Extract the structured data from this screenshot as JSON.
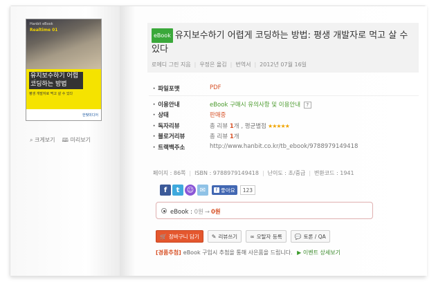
{
  "cover": {
    "series_small": "Hanbit eBook",
    "series_name": "Realtime 01",
    "title_line1": "유지보수하기 어렵게",
    "title_line2": "코딩하는 방법",
    "subtitle": "평생 개발자로 먹고 살 수 있다",
    "publisher": "한빛미디어"
  },
  "zoom": {
    "enlarge": "크게보기",
    "preview": "미리보기"
  },
  "product": {
    "badge": "eBook",
    "title": "유지보수하기 어렵게 코딩하는 방법: 평생 개발자로 먹고 살 수 있다",
    "author": "로에디 그린 지음",
    "translator_credit": "우정은 옮김",
    "type": "번역서",
    "date": "2012년 07월 16일"
  },
  "info": {
    "file_format_label": "파일포맷",
    "file_format_value": "PDF",
    "usage_label": "이용안내",
    "usage_value": "eBook 구매시 유의사항 및 이용안내",
    "usage_help": "?",
    "status_label": "상태",
    "status_value": "판매중",
    "reader_review_label": "독자리뷰",
    "reader_review_prefix": "총 리뷰",
    "reader_review_count": "1",
    "reader_review_mid": "개 , 평균별점",
    "reader_review_stars": "★★★★★",
    "blog_review_label": "블로거리뷰",
    "blog_review_prefix": "총 리뷰",
    "blog_review_count": "1",
    "blog_review_suffix": "개",
    "trackback_label": "트랙백주소",
    "trackback_value": "http://www.hanbit.co.kr/tb_ebook/9788979149418"
  },
  "specs": {
    "pages": "페이지 : 86쪽",
    "isbn": "ISBN : 9788979149418",
    "level": "난이도 : 초/중급",
    "code": "변환코드 : 1941"
  },
  "social": {
    "facebook": "f",
    "twitter": "t",
    "me2day": "☺",
    "mail": "✉",
    "like_label": "좋아요",
    "like_count": "123"
  },
  "price": {
    "label": "eBook :",
    "original": "0원",
    "arrow": "→",
    "final": "0원"
  },
  "actions": {
    "cart": "장바구니 담기",
    "review": "리뷰쓰기",
    "errata": "오탈자 등록",
    "discuss": "토론 / QA"
  },
  "event": {
    "tag": "[경품추첨]",
    "text": "eBook 구입시 추첨을 통해 사은품을 드립니다.",
    "link": "이벤트 상세보기"
  }
}
